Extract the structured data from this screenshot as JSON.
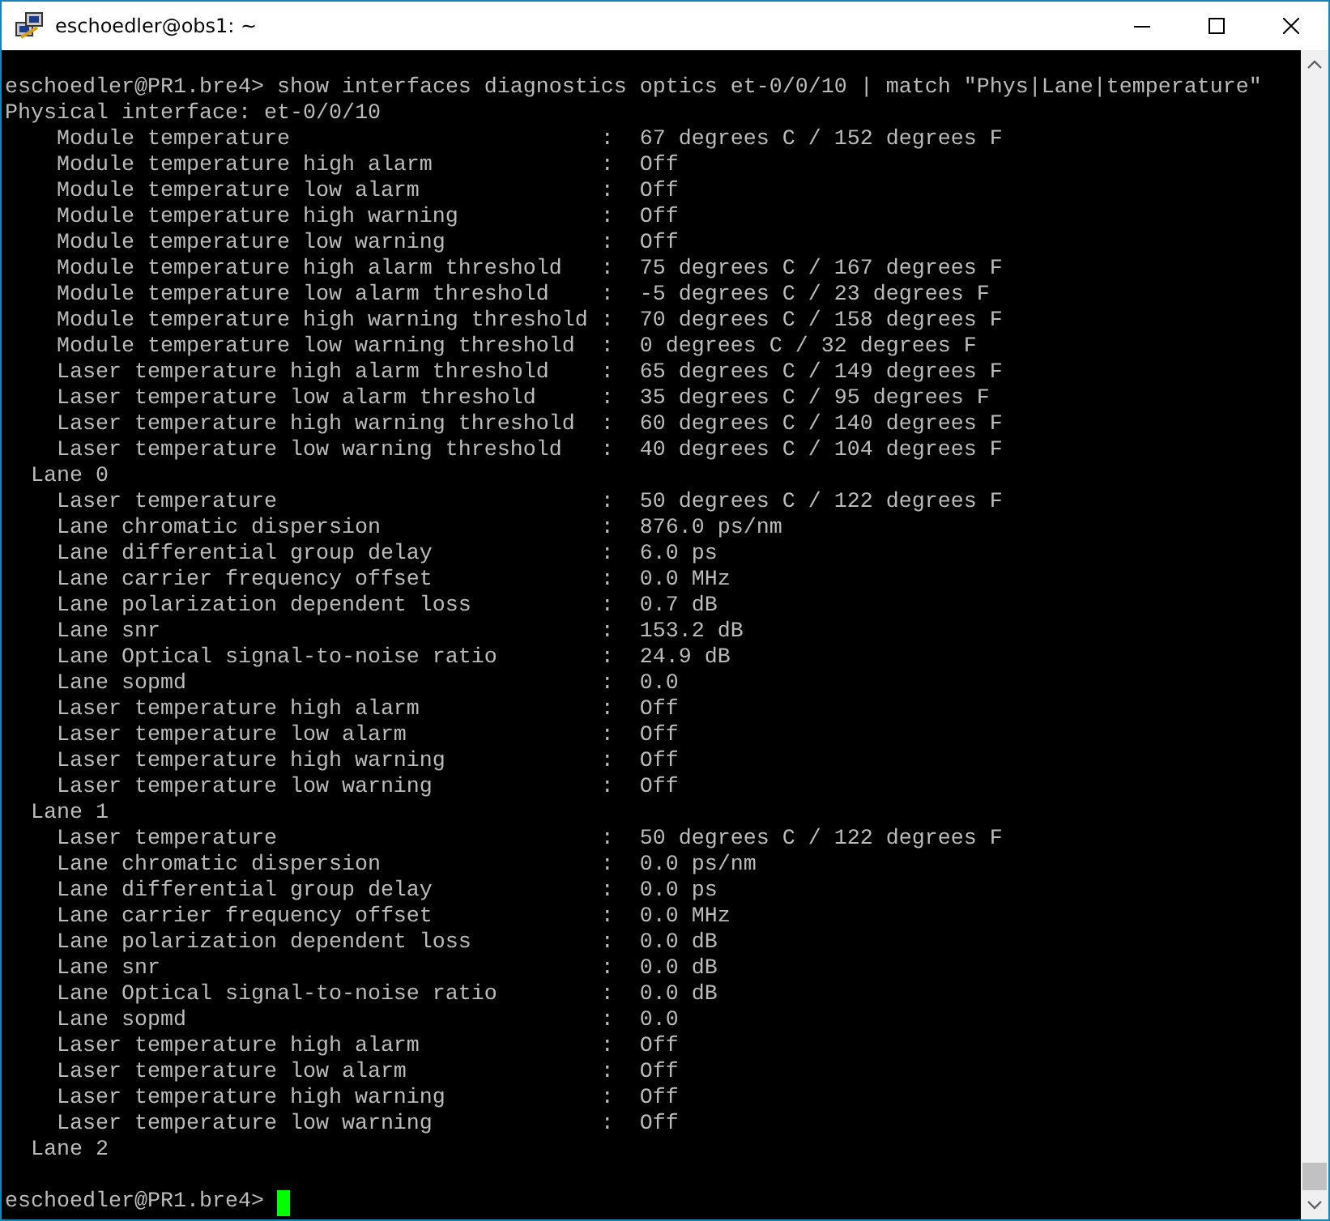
{
  "window": {
    "title": "eschoedler@obs1: ~"
  },
  "command": "eschoedler@PR1.bre4> show interfaces diagnostics optics et-0/0/10 | match \"Phys|Lane|temperature\"",
  "sections": [
    {
      "kind": "interface",
      "heading": "Physical interface: et-0/0/10",
      "rows": [
        {
          "label": "Module temperature",
          "rest": ":  67 degrees C / 152 degrees F"
        },
        {
          "label": "Module temperature high alarm",
          "rest": ":  Off"
        },
        {
          "label": "Module temperature low alarm",
          "rest": ":  Off"
        },
        {
          "label": "Module temperature high warning",
          "rest": ":  Off"
        },
        {
          "label": "Module temperature low warning",
          "rest": ":  Off"
        },
        {
          "label": "Module temperature high alarm threshold",
          "rest": ":  75 degrees C / 167 degrees F"
        },
        {
          "label": "Module temperature low alarm threshold",
          "rest": ":  -5 degrees C / 23 degrees F"
        },
        {
          "label": "Module temperature high warning threshold",
          "rest": ":  70 degrees C / 158 degrees F"
        },
        {
          "label": "Module temperature low warning threshold",
          "rest": ":  0 degrees C / 32 degrees F"
        },
        {
          "label": "Laser temperature high alarm threshold",
          "rest": ":  65 degrees C / 149 degrees F"
        },
        {
          "label": "Laser temperature low alarm threshold",
          "rest": ":  35 degrees C / 95 degrees F"
        },
        {
          "label": "Laser temperature high warning threshold",
          "rest": ":  60 degrees C / 140 degrees F"
        },
        {
          "label": "Laser temperature low warning threshold",
          "rest": ":  40 degrees C / 104 degrees F"
        }
      ]
    },
    {
      "kind": "lane",
      "heading": "Lane 0",
      "rows": [
        {
          "label": "Laser temperature",
          "rest": ":  50 degrees C / 122 degrees F"
        },
        {
          "label": "Lane chromatic dispersion",
          "rest": ":  876.0 ps/nm"
        },
        {
          "label": "Lane differential group delay",
          "rest": ":  6.0 ps"
        },
        {
          "label": "Lane carrier frequency offset",
          "rest": ":  0.0 MHz"
        },
        {
          "label": "Lane polarization dependent loss",
          "rest": ":  0.7 dB"
        },
        {
          "label": "Lane snr",
          "rest": ":  153.2 dB"
        },
        {
          "label": "Lane Optical signal-to-noise ratio",
          "rest": ":  24.9 dB"
        },
        {
          "label": "Lane sopmd",
          "rest": ":  0.0"
        },
        {
          "label": "Laser temperature high alarm",
          "rest": ":  Off"
        },
        {
          "label": "Laser temperature low alarm",
          "rest": ":  Off"
        },
        {
          "label": "Laser temperature high warning",
          "rest": ":  Off"
        },
        {
          "label": "Laser temperature low warning",
          "rest": ":  Off"
        }
      ]
    },
    {
      "kind": "lane",
      "heading": "Lane 1",
      "rows": [
        {
          "label": "Laser temperature",
          "rest": ":  50 degrees C / 122 degrees F"
        },
        {
          "label": "Lane chromatic dispersion",
          "rest": ":  0.0 ps/nm"
        },
        {
          "label": "Lane differential group delay",
          "rest": ":  0.0 ps"
        },
        {
          "label": "Lane carrier frequency offset",
          "rest": ":  0.0 MHz"
        },
        {
          "label": "Lane polarization dependent loss",
          "rest": ":  0.0 dB"
        },
        {
          "label": "Lane snr",
          "rest": ":  0.0 dB"
        },
        {
          "label": "Lane Optical signal-to-noise ratio",
          "rest": ":  0.0 dB"
        },
        {
          "label": "Lane sopmd",
          "rest": ":  0.0"
        },
        {
          "label": "Laser temperature high alarm",
          "rest": ":  Off"
        },
        {
          "label": "Laser temperature low alarm",
          "rest": ":  Off"
        },
        {
          "label": "Laser temperature high warning",
          "rest": ":  Off"
        },
        {
          "label": "Laser temperature low warning",
          "rest": ":  Off"
        }
      ]
    },
    {
      "kind": "lane",
      "heading": "Lane 2"
    }
  ],
  "prompt": "eschoedler@PR1.bre4>"
}
